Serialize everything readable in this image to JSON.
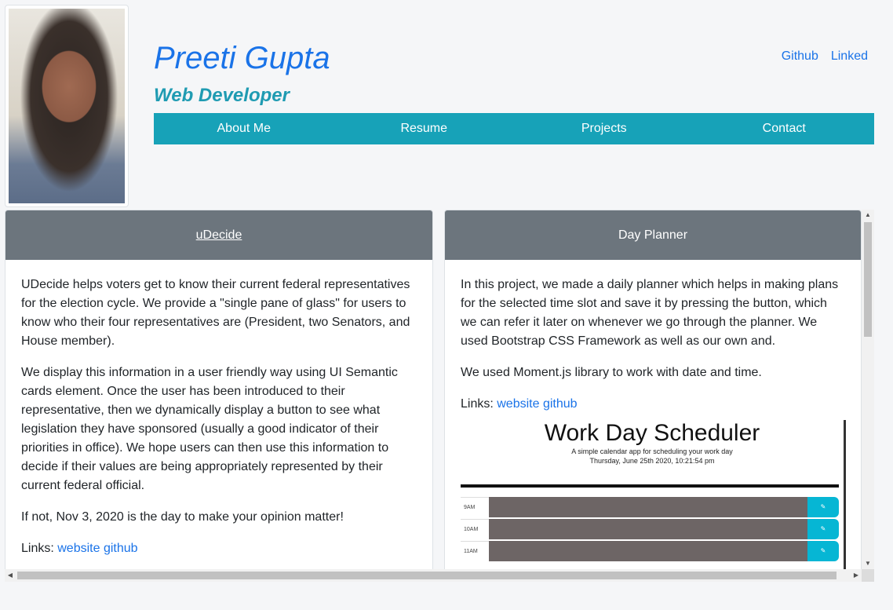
{
  "header": {
    "name": "Preeti Gupta",
    "role": "Web Developer",
    "links": [
      "Github",
      "Linked"
    ]
  },
  "nav": [
    "About Me",
    "Resume",
    "Projects",
    "Contact"
  ],
  "cards": [
    {
      "title": "uDecide",
      "paragraphs": [
        "UDecide helps voters get to know their current federal representatives for the election cycle. We provide a \"single pane of glass\" for users to know who their four representatives are (President, two Senators, and House member).",
        "We display this information in a user friendly way using UI Semantic cards element. Once the user has been introduced to their representative, then we dynamically display a button to see what legislation they have sponsored (usually a good indicator of their priorities in office). We hope users can then use this information to decide if their values are being appropriately represented by their current federal official.",
        "If not, Nov 3, 2020 is the day to make your opinion matter!"
      ],
      "links_label": "Links:",
      "links": [
        "website",
        "github"
      ]
    },
    {
      "title": "Day Planner",
      "paragraphs": [
        "In this project, we made a daily planner which helps in making plans for the selected time slot and save it by pressing the button, which we can refer it later on whenever we go through the planner. We used Bootstrap CSS Framework as well as our own and.",
        "We used Moment.js library to work with date and time."
      ],
      "links_label": "Links:",
      "links": [
        "website",
        "github"
      ],
      "preview": {
        "title": "Work Day Scheduler",
        "subtitle": "A simple calendar app for scheduling your work day",
        "date": "Thursday, June 25th 2020, 10:21:54 pm",
        "hours": [
          "9AM",
          "10AM",
          "11AM"
        ],
        "save_icon": "save-icon"
      }
    }
  ],
  "colors": {
    "accent": "#17a2b8",
    "name": "#1a73e8",
    "role": "#1f9bb2",
    "card_header": "#6c757d"
  }
}
